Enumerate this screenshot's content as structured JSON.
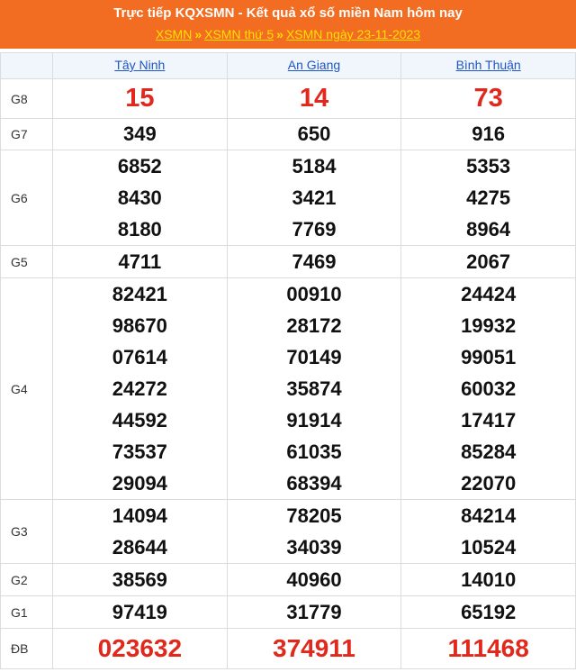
{
  "header": {
    "title": "Trực tiếp KQXSMN - Kết quả xổ số miền Nam hôm nay",
    "breadcrumbs": [
      "XSMN",
      "XSMN thứ 5",
      "XSMN ngày 23-11-2023"
    ],
    "separator": "»"
  },
  "colors": {
    "header_bg": "#f26d21",
    "link": "#1f56c9",
    "highlight": "#e0281c",
    "crumb": "#ffe000"
  },
  "provinces": [
    "Tây Ninh",
    "An Giang",
    "Bình Thuận"
  ],
  "prizes": [
    {
      "label": "G8",
      "values": [
        [
          "15"
        ],
        [
          "14"
        ],
        [
          "73"
        ]
      ]
    },
    {
      "label": "G7",
      "values": [
        [
          "349"
        ],
        [
          "650"
        ],
        [
          "916"
        ]
      ]
    },
    {
      "label": "G6",
      "values": [
        [
          "6852",
          "8430",
          "8180"
        ],
        [
          "5184",
          "3421",
          "7769"
        ],
        [
          "5353",
          "4275",
          "8964"
        ]
      ]
    },
    {
      "label": "G5",
      "values": [
        [
          "4711"
        ],
        [
          "7469"
        ],
        [
          "2067"
        ]
      ]
    },
    {
      "label": "G4",
      "values": [
        [
          "82421",
          "98670",
          "07614",
          "24272",
          "44592",
          "73537",
          "29094"
        ],
        [
          "00910",
          "28172",
          "70149",
          "35874",
          "91914",
          "61035",
          "68394"
        ],
        [
          "24424",
          "19932",
          "99051",
          "60032",
          "17417",
          "85284",
          "22070"
        ]
      ]
    },
    {
      "label": "G3",
      "values": [
        [
          "14094",
          "28644"
        ],
        [
          "78205",
          "34039"
        ],
        [
          "84214",
          "10524"
        ]
      ]
    },
    {
      "label": "G2",
      "values": [
        [
          "38569"
        ],
        [
          "40960"
        ],
        [
          "14010"
        ]
      ]
    },
    {
      "label": "G1",
      "values": [
        [
          "97419"
        ],
        [
          "31779"
        ],
        [
          "65192"
        ]
      ]
    },
    {
      "label": "ĐB",
      "values": [
        [
          "023632"
        ],
        [
          "374911"
        ],
        [
          "111468"
        ]
      ]
    }
  ]
}
